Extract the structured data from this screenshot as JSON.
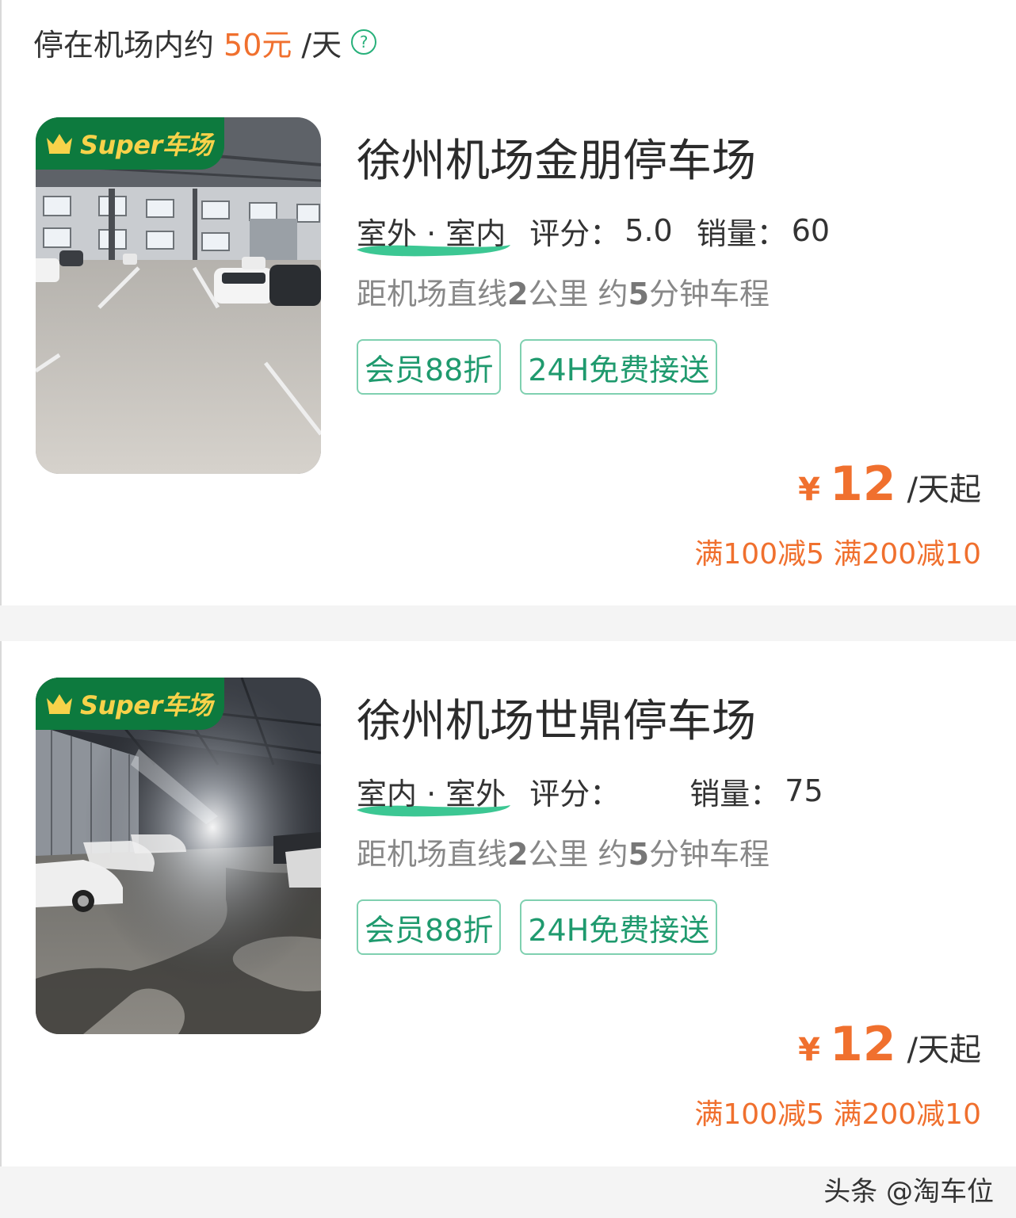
{
  "header": {
    "prefix": "停在机场内约",
    "price": "50元",
    "unit": "/天",
    "help_icon": "question-circle-icon",
    "help_glyph": "?"
  },
  "colors": {
    "accent_orange": "#f0702e",
    "accent_green": "#27b07a",
    "badge_green": "#0d7a3e",
    "badge_gold": "#f7d24a"
  },
  "lots": [
    {
      "badge": "Super车场",
      "name": "徐州机场金朋停车场",
      "type": "室外 · 室内",
      "rating_label": "评分：",
      "rating": "5.0",
      "sales_label": "销量：",
      "sales": "60",
      "distance_prefix": "距机场直线",
      "distance_km": "2",
      "distance_mid": "公里 约",
      "distance_min": "5",
      "distance_suffix": "分钟车程",
      "tags": [
        "会员88折",
        "24H免费接送"
      ],
      "currency": "¥",
      "price": "12",
      "price_unit": "/天起",
      "promo": "满100减5 满200减10",
      "photo": "indoor-garage-daylight"
    },
    {
      "badge": "Super车场",
      "name": "徐州机场世鼎停车场",
      "type": "室内 · 室外",
      "rating_label": "评分：",
      "rating": "",
      "sales_label": "销量：",
      "sales": "75",
      "distance_prefix": "距机场直线",
      "distance_km": "2",
      "distance_mid": "公里 约",
      "distance_min": "5",
      "distance_suffix": "分钟车程",
      "tags": [
        "会员88折",
        "24H免费接送"
      ],
      "currency": "¥",
      "price": "12",
      "price_unit": "/天起",
      "promo": "满100减5 满200减10",
      "photo": "indoor-garage-dark"
    }
  ],
  "watermark": "头条 @淘车位"
}
